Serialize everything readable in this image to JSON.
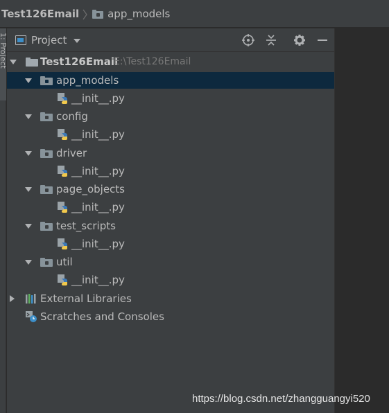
{
  "breadcrumb": {
    "project": "Test126Email",
    "folder": "app_models"
  },
  "left_stripe": {
    "tab_label": "1: Project"
  },
  "project_panel": {
    "title": "Project",
    "icons": [
      "locate-icon",
      "collapse-all-icon",
      "gear-icon",
      "minimize-icon"
    ]
  },
  "tree": {
    "root": {
      "name": "Test126Email",
      "path": "E:\\Test126Email"
    },
    "folders": [
      {
        "name": "app_models",
        "file": "__init__.py",
        "selected": true
      },
      {
        "name": "config",
        "file": "__init__.py",
        "selected": false
      },
      {
        "name": "driver",
        "file": "__init__.py",
        "selected": false
      },
      {
        "name": "page_objects",
        "file": "__init__.py",
        "selected": false
      },
      {
        "name": "test_scripts",
        "file": "__init__.py",
        "selected": false
      },
      {
        "name": "util",
        "file": "__init__.py",
        "selected": false
      }
    ],
    "external_libraries": "External Libraries",
    "scratches": "Scratches and Consoles"
  },
  "colors": {
    "selection": "#0d293e",
    "panel_bg": "#3c3f41",
    "editor_bg": "#2b2b2b",
    "text": "#bbbbbb",
    "python_blue": "#3d7ab8",
    "python_yellow": "#f2c94c"
  },
  "watermark": "https://blog.csdn.net/zhangguangyi520"
}
